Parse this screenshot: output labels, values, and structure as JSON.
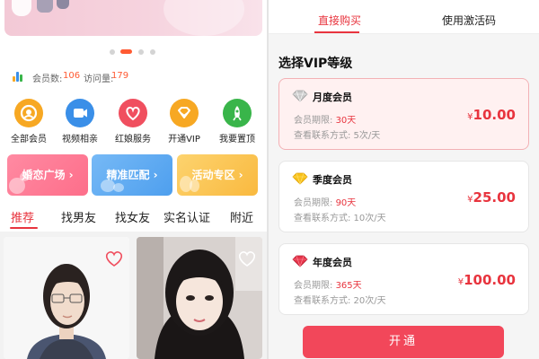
{
  "left": {
    "stats": {
      "members_label": "会员数:",
      "members_value": "106",
      "visits_label": "访问量:",
      "visits_value": "179"
    },
    "quick_nav": [
      {
        "label": "全部会员",
        "icon": "person-icon",
        "color": "#f7a823"
      },
      {
        "label": "视频相亲",
        "icon": "video-icon",
        "color": "#3a8fe8"
      },
      {
        "label": "红娘服务",
        "icon": "heart-icon",
        "color": "#f04f5f"
      },
      {
        "label": "开通VIP",
        "icon": "diamond-icon",
        "color": "#f7a823"
      },
      {
        "label": "我要置顶",
        "icon": "rocket-icon",
        "color": "#39b54a"
      }
    ],
    "promos": [
      {
        "label": "婚恋广场 ›",
        "color": "#fd6e8a"
      },
      {
        "label": "精准匹配 ›",
        "color": "#5aa8f2"
      },
      {
        "label": "活动专区 ›",
        "color": "#fbc04d"
      }
    ],
    "tabs": [
      "推荐",
      "找男友",
      "找女友",
      "实名认证",
      "附近"
    ],
    "active_tab": "推荐"
  },
  "right": {
    "tabs": [
      "直接购买",
      "使用激活码"
    ],
    "active_tab": "直接购买",
    "section_title": "选择VIP等级",
    "plans": [
      {
        "name": "月度会员",
        "term_label": "会员期限:",
        "term_value": "30天",
        "contact": "查看联系方式: 5次/天",
        "currency": "¥",
        "price": "10.00",
        "icon": "silver-diamond-icon",
        "selected": true
      },
      {
        "name": "季度会员",
        "term_label": "会员期限:",
        "term_value": "90天",
        "contact": "查看联系方式: 10次/天",
        "currency": "¥",
        "price": "25.00",
        "icon": "gold-diamond-icon",
        "selected": false
      },
      {
        "name": "年度会员",
        "term_label": "会员期限:",
        "term_value": "365天",
        "contact": "查看联系方式: 20次/天",
        "currency": "¥",
        "price": "100.00",
        "icon": "red-diamond-icon",
        "selected": false
      }
    ],
    "open_button": "开通"
  },
  "colors": {
    "accent": "#e8343e",
    "button": "#f2475a",
    "stat_value": "#ff5a32"
  }
}
